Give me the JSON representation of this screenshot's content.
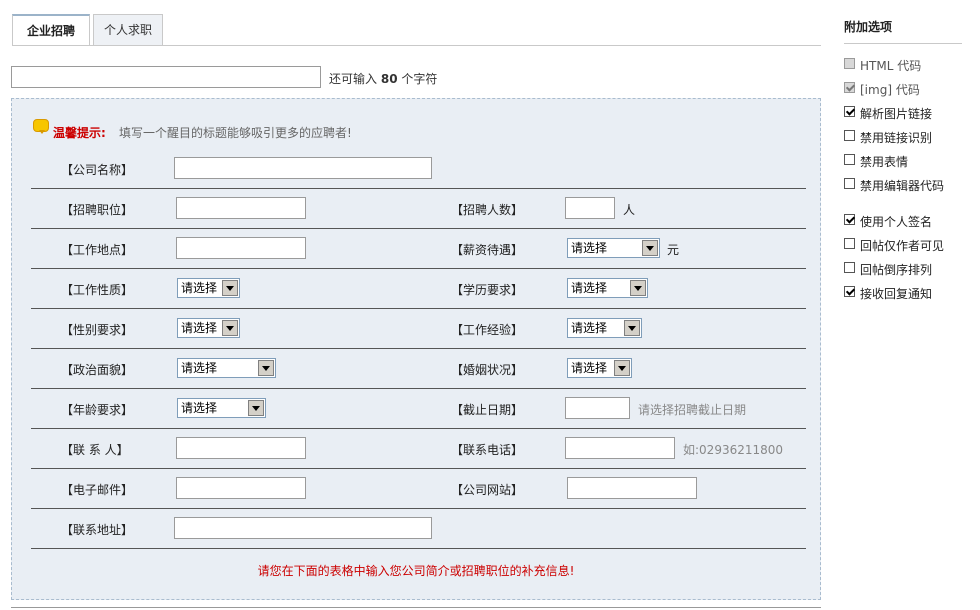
{
  "tabs": [
    {
      "label": "企业招聘",
      "active": true
    },
    {
      "label": "个人求职",
      "active": false
    }
  ],
  "title_input": {
    "value": "",
    "counter_prefix": "还可输入",
    "counter_value": "80",
    "counter_suffix": "个字符"
  },
  "tip": {
    "label": "温馨提示:",
    "text": "填写一个醒目的标题能够吸引更多的应聘者!"
  },
  "form": {
    "company_name": "【公司名称】",
    "position": "【招聘职位】",
    "headcount": "【招聘人数】",
    "headcount_unit": "人",
    "location": "【工作地点】",
    "salary": "【薪资待遇】",
    "salary_select": "请选择",
    "salary_unit": "元",
    "job_type": "【工作性质】",
    "job_type_select": "请选择",
    "education": "【学历要求】",
    "education_select": "请选择",
    "gender": "【性别要求】",
    "gender_select": "请选择",
    "experience": "【工作经验】",
    "experience_select": "请选择",
    "politics": "【政治面貌】",
    "politics_select": "请选择",
    "marriage": "【婚姻状况】",
    "marriage_select": "请选择",
    "age": "【年龄要求】",
    "age_select": "请选择",
    "deadline": "【截止日期】",
    "deadline_hint": "请选择招聘截止日期",
    "contact": "【联 系 人】",
    "phone": "【联系电话】",
    "phone_hint": "如:02936211800",
    "email": "【电子邮件】",
    "website": "【公司网站】",
    "address": "【联系地址】",
    "notice": "请您在下面的表格中输入您公司简介或招聘职位的补充信息!"
  },
  "sidebar": {
    "title": "附加选项",
    "options": [
      {
        "label": "HTML 代码",
        "checked": false,
        "disabled": true
      },
      {
        "label": "[img] 代码",
        "checked": true,
        "disabled": true
      },
      {
        "label": "解析图片链接",
        "checked": true,
        "disabled": false
      },
      {
        "label": "禁用链接识别",
        "checked": false,
        "disabled": false
      },
      {
        "label": "禁用表情",
        "checked": false,
        "disabled": false
      },
      {
        "label": "禁用编辑器代码",
        "checked": false,
        "disabled": false
      },
      {
        "label": "使用个人签名",
        "checked": true,
        "disabled": false
      },
      {
        "label": "回帖仅作者可见",
        "checked": false,
        "disabled": false
      },
      {
        "label": "回帖倒序排列",
        "checked": false,
        "disabled": false
      },
      {
        "label": "接收回复通知",
        "checked": true,
        "disabled": false
      }
    ]
  }
}
